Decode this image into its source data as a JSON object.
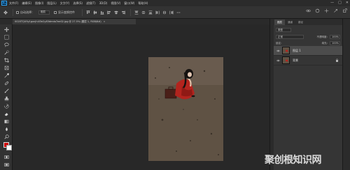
{
  "app": {
    "logo_text": "Ps",
    "menu": [
      "文件(F)",
      "编辑(E)",
      "图像(I)",
      "图层(L)",
      "文字(Y)",
      "选择(S)",
      "滤镜(T)",
      "3D(D)",
      "视图(V)",
      "窗口(W)",
      "帮助(H)"
    ],
    "window_controls": [
      "—",
      "□",
      "✕"
    ]
  },
  "options_bar": {
    "auto_select_label": "自动选择：",
    "auto_select_value": "图层",
    "show_transform_label": "显示变换控件"
  },
  "document": {
    "tab_title": "0020TQU9y1gxnjh4l3e2y83dmdo7ee02.jpg @ 27.5% (图层 1, RGB/8#)",
    "tab_close": "×"
  },
  "panels": {
    "tabs": [
      "图层",
      "通道",
      "路径"
    ],
    "active_tab": "图层",
    "filter_label": "类型",
    "blend_mode": "正常",
    "opacity_label": "不透明度：",
    "opacity_value": "100%",
    "lock_label": "锁定：",
    "fill_label": "填充：",
    "fill_value": "100%",
    "layers": [
      {
        "name": "图层 1",
        "selected": true,
        "locked": false
      },
      {
        "name": "背景",
        "selected": false,
        "locked": true
      }
    ]
  },
  "colors": {
    "foreground": "#cc0000",
    "background": "#ffffff",
    "accent": "#31a8ff"
  },
  "watermark": "聚创根知识网"
}
